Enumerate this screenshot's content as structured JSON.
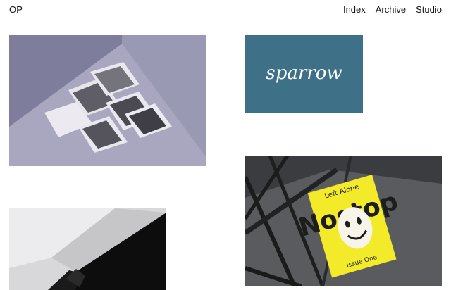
{
  "header": {
    "logo": "OP",
    "nav": [
      {
        "label": "Index"
      },
      {
        "label": "Archive"
      },
      {
        "label": "Studio"
      }
    ]
  },
  "projects": [
    {
      "name": "photo-cards-project"
    },
    {
      "name": "sparrow-project",
      "wordmark": "sparrow"
    },
    {
      "name": "left-alone-magazine-project",
      "kicker": "Left Alone",
      "title": "Nostop",
      "issue": "Issue One"
    },
    {
      "name": "monochrome-sculpture-project"
    }
  ],
  "colors": {
    "background": "#ffffff",
    "sparrow_blue": "#3e7187",
    "poster_yellow": "#f3ea2a",
    "studio_lilac": "#8d8ca8"
  }
}
